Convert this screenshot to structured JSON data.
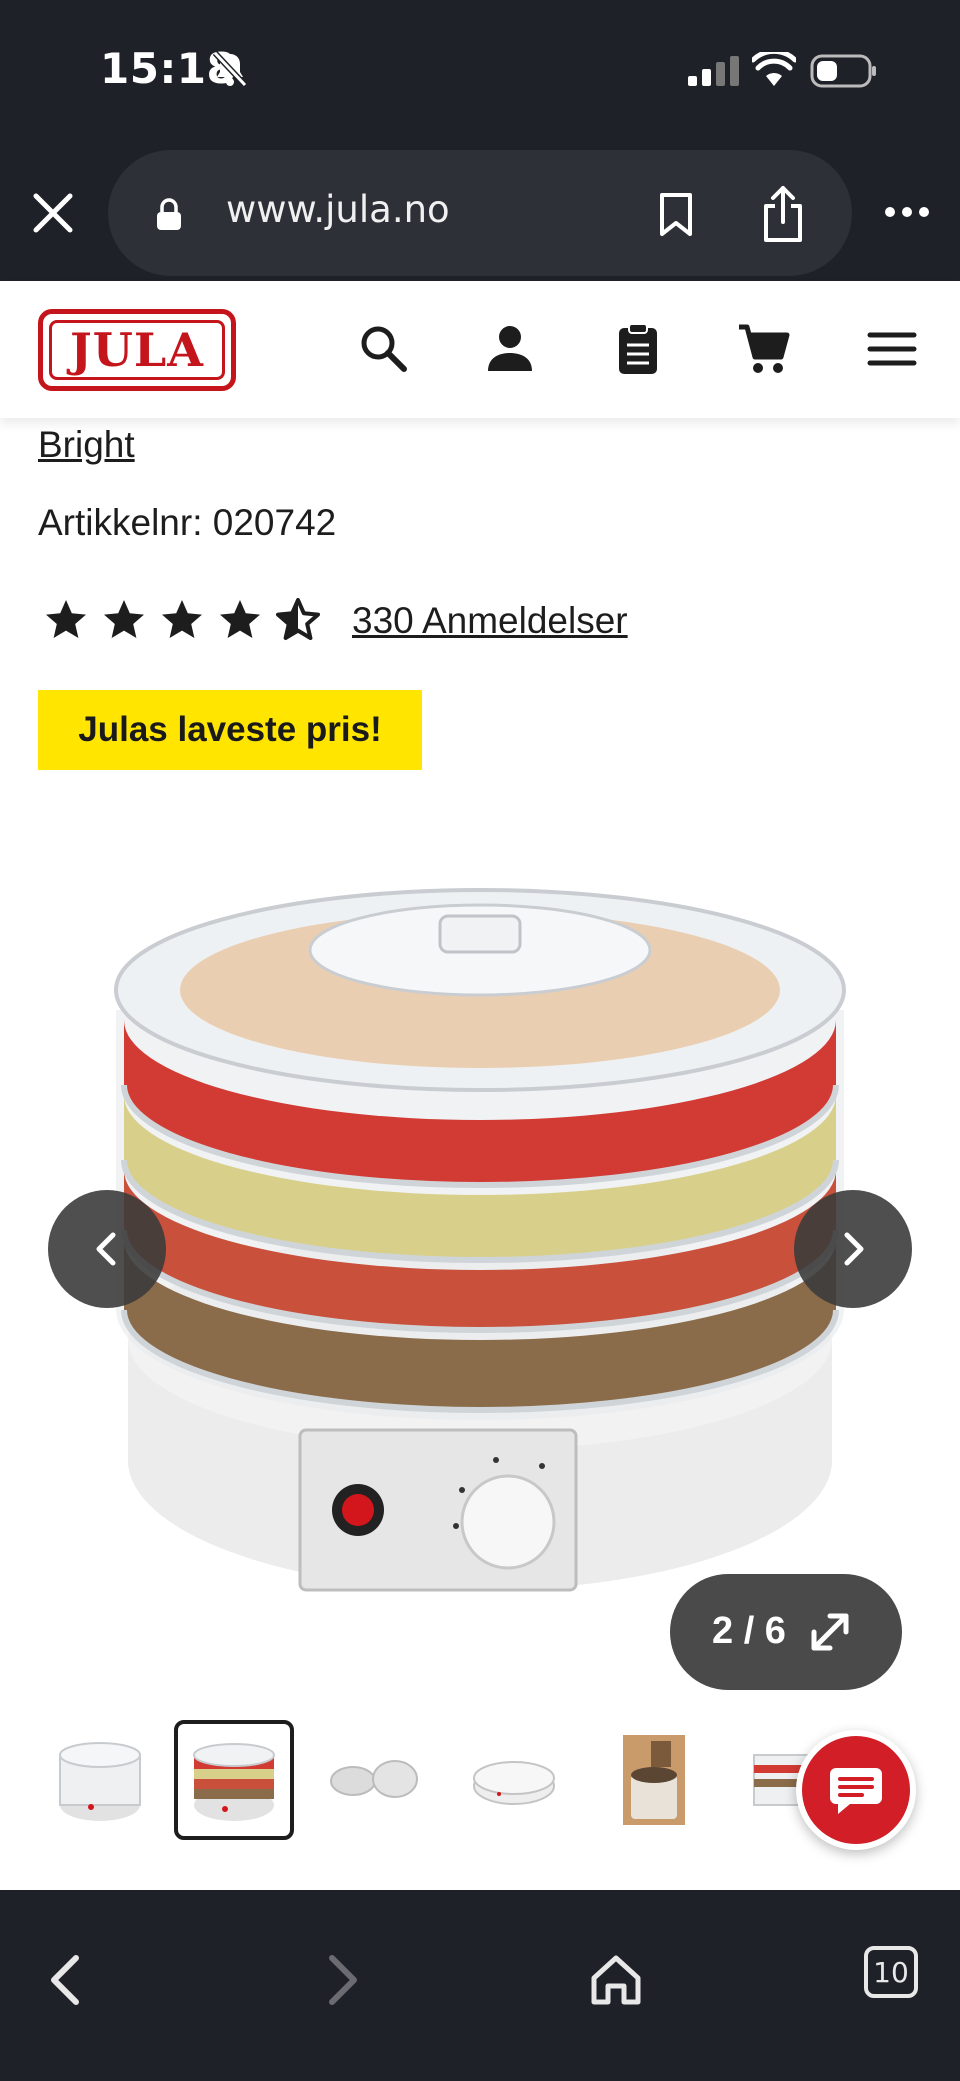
{
  "status_bar": {
    "time": "15:18",
    "icons": [
      "bell-off-icon",
      "cellular-signal-icon",
      "wifi-icon",
      "battery-icon"
    ]
  },
  "browser": {
    "url": "www.jula.no",
    "icons": [
      "close-icon",
      "lock-icon",
      "bookmark-icon",
      "share-icon",
      "more-icon"
    ]
  },
  "site_header": {
    "logo_text": "JULA",
    "icons": [
      "search-icon",
      "account-icon",
      "shopping-list-icon",
      "cart-icon",
      "menu-icon"
    ]
  },
  "product": {
    "brand": "Bright",
    "article_number": "Artikkelnr: 020742",
    "rating": 4.5,
    "rating_max": 5,
    "reviews_label": "330 Anmeldelser",
    "promo_badge": "Julas laveste pris!"
  },
  "gallery": {
    "counter": "2 / 6",
    "current_index": 2,
    "total": 6,
    "thumbnails_visible": 6
  },
  "bottom_toolbar": {
    "tabs_count": "10",
    "icons": [
      "back-icon",
      "forward-icon",
      "home-icon",
      "tabs-icon"
    ]
  },
  "colors": {
    "brand_red": "#c4151c",
    "promo_yellow": "#ffe500",
    "chrome_dark": "#1f2128",
    "chat_red": "#d11e27"
  }
}
